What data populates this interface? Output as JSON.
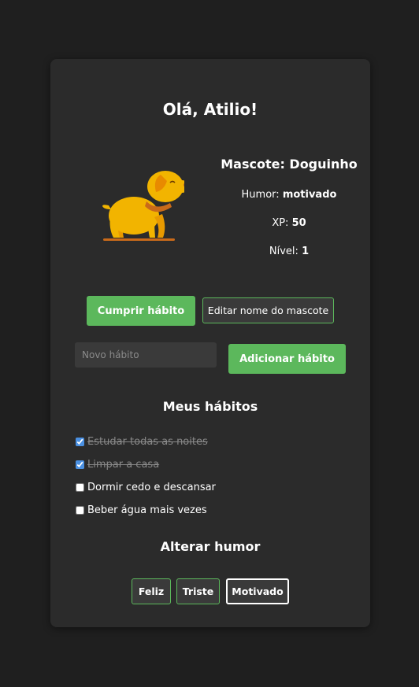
{
  "greeting": "Olá, Atilio!",
  "pet": {
    "name_label": "Mascote: Doguinho",
    "mood_label": "Humor:",
    "mood_value": "motivado",
    "xp_label": "XP:",
    "xp_value": "50",
    "level_label": "Nível:",
    "level_value": "1",
    "icon": "dog-mascot-icon"
  },
  "actions": {
    "complete_habit": "Cumprir hábito",
    "edit_pet_name": "Editar nome do mascote"
  },
  "new_habit": {
    "placeholder": "Novo hábito",
    "value": "",
    "add_button": "Adicionar hábito"
  },
  "habits": {
    "title": "Meus hábitos",
    "items": [
      {
        "label": "Estudar todas as noites",
        "done": true
      },
      {
        "label": "Limpar a casa",
        "done": true
      },
      {
        "label": "Dormir cedo e descansar",
        "done": false
      },
      {
        "label": "Beber água mais vezes",
        "done": false
      }
    ]
  },
  "mood": {
    "title": "Alterar humor",
    "options": [
      "Feliz",
      "Triste",
      "Motivado"
    ],
    "selected": "Motivado"
  },
  "colors": {
    "background": "#1f1f1f",
    "card": "#2b2b2b",
    "accent_green": "#5cb85c",
    "dog_body": "#f2b400",
    "dog_ear": "#e88a00",
    "collar": "#c96a1a"
  }
}
